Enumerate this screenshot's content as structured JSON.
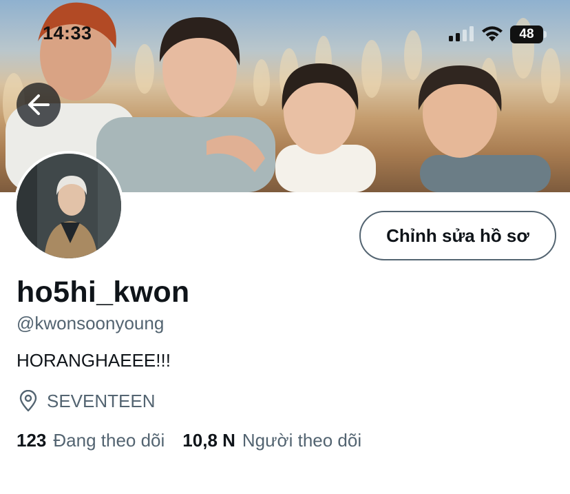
{
  "status_bar": {
    "time": "14:33",
    "battery": "48",
    "battery_level": 0.48
  },
  "header": {
    "back_icon": "arrow-left-icon"
  },
  "profile": {
    "edit_button": "Chỉnh sửa hồ sơ",
    "display_name": "ho5hi_kwon",
    "handle": "@kwonsoonyoung",
    "bio": "HORANGHAEEE!!!",
    "location_icon": "location-pin-icon",
    "location": "SEVENTEEN",
    "following_count": "123",
    "following_label": "Đang theo dõi",
    "followers_count": "10,8 N",
    "followers_label": "Người theo dõi"
  },
  "colors": {
    "text_primary": "#0f1419",
    "text_secondary": "#536471",
    "button_border": "#536471"
  }
}
